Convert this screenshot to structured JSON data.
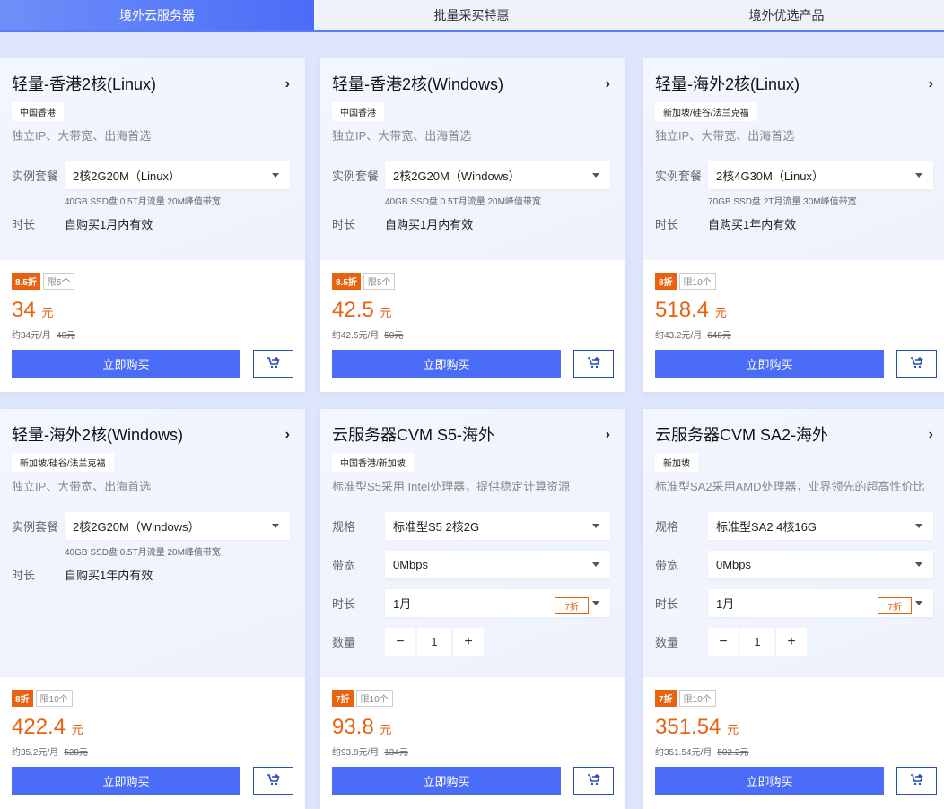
{
  "tabs": [
    "境外云服务器",
    "批量采买特惠",
    "境外优选产品"
  ],
  "buy_label": "立即购买",
  "currency": "元",
  "cards": [
    {
      "title": "轻量-香港2核(Linux)",
      "tag": "中国香港",
      "desc": "独立IP、大带宽、出海首选",
      "fields": [
        {
          "label": "实例套餐",
          "value": "2核2G20M（Linux）"
        }
      ],
      "spec": "40GB SSD盘 0.5T月流量 20M峰值带宽",
      "duration_label": "时长",
      "duration": "自购买1月内有效",
      "discount": "8.5折",
      "limit": "限5个",
      "price": "34",
      "monthly": "约34元/月",
      "original": "40元"
    },
    {
      "title": "轻量-香港2核(Windows)",
      "tag": "中国香港",
      "desc": "独立IP、大带宽、出海首选",
      "fields": [
        {
          "label": "实例套餐",
          "value": "2核2G20M（Windows）"
        }
      ],
      "spec": "40GB SSD盘 0.5T月流量 20M峰值带宽",
      "duration_label": "时长",
      "duration": "自购买1月内有效",
      "discount": "8.5折",
      "limit": "限5个",
      "price": "42.5",
      "monthly": "约42.5元/月",
      "original": "50元"
    },
    {
      "title": "轻量-海外2核(Linux)",
      "tag": "新加坡/硅谷/法兰克福",
      "desc": "独立IP、大带宽、出海首选",
      "fields": [
        {
          "label": "实例套餐",
          "value": "2核4G30M（Linux）"
        }
      ],
      "spec": "70GB SSD盘 2T月流量 30M峰值带宽",
      "duration_label": "时长",
      "duration": "自购买1年内有效",
      "discount": "8折",
      "limit": "限10个",
      "price": "518.4",
      "monthly": "约43.2元/月",
      "original": "648元"
    },
    {
      "title": "轻量-海外2核(Windows)",
      "tag": "新加坡/硅谷/法兰克福",
      "desc": "独立IP、大带宽、出海首选",
      "fields": [
        {
          "label": "实例套餐",
          "value": "2核2G20M（Windows）"
        }
      ],
      "spec": "40GB SSD盘 0.5T月流量 20M峰值带宽",
      "duration_label": "时长",
      "duration": "自购买1年内有效",
      "discount": "8折",
      "limit": "限10个",
      "price": "422.4",
      "monthly": "约35.2元/月",
      "original": "528元"
    },
    {
      "title": "云服务器CVM S5-海外",
      "tag": "中国香港/新加坡",
      "desc": "标准型S5采用 Intel处理器，提供稳定计算资源",
      "fields": [
        {
          "label": "规格",
          "value": "标准型S5 2核2G"
        },
        {
          "label": "带宽",
          "value": "0Mbps"
        },
        {
          "label": "时长",
          "value": "1月",
          "tag": "7折"
        }
      ],
      "qty_label": "数量",
      "qty": "1",
      "discount": "7折",
      "limit": "限10个",
      "price": "93.8",
      "monthly": "约93.8元/月",
      "original": "134元"
    },
    {
      "title": "云服务器CVM SA2-海外",
      "tag": "新加坡",
      "desc": "标准型SA2采用AMD处理器，业界领先的超高性价比",
      "fields": [
        {
          "label": "规格",
          "value": "标准型SA2 4核16G"
        },
        {
          "label": "带宽",
          "value": "0Mbps"
        },
        {
          "label": "时长",
          "value": "1月",
          "tag": "7折"
        }
      ],
      "qty_label": "数量",
      "qty": "1",
      "discount": "7折",
      "limit": "限10个",
      "price": "351.54",
      "monthly": "约351.54元/月",
      "original": "502.2元"
    }
  ]
}
